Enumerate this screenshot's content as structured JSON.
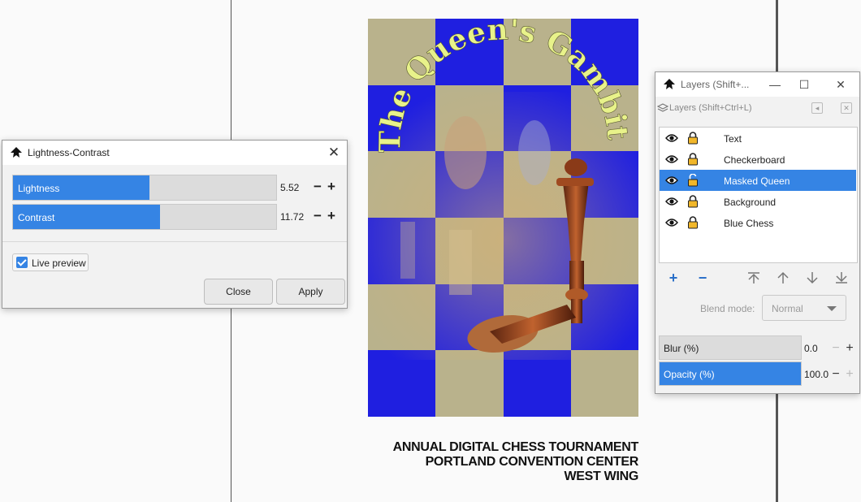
{
  "poster": {
    "title_curve": "The Queen's Gambit",
    "caption": [
      "ANNUAL DIGITAL CHESS TOURNAMENT",
      "PORTLAND CONVENTION CENTER",
      "WEST WING"
    ],
    "colors": {
      "blue": "#1f1fe0",
      "tan": "#b9b28c",
      "title": "#e8f28a"
    }
  },
  "lightness_dialog": {
    "title": "Lightness-Contrast",
    "icon": "inkscape-icon",
    "close_icon": "close-icon",
    "lightness": {
      "label": "Lightness",
      "value": "5.52",
      "level": 0.52
    },
    "contrast": {
      "label": "Contrast",
      "value": "11.72",
      "level": 0.56
    },
    "minus": "−",
    "plus": "+",
    "live_preview": {
      "label": "Live preview",
      "checked": true
    },
    "close_button": "Close",
    "apply_button": "Apply"
  },
  "layers_window": {
    "title": "Layers (Shift+...",
    "tab_title": "Layers (Shift+Ctrl+L)",
    "controls": {
      "minimize": "—",
      "maximize": "☐",
      "close": "✕"
    },
    "layers": [
      {
        "name": "Text",
        "selected": false
      },
      {
        "name": "Checkerboard",
        "selected": false
      },
      {
        "name": "Masked Queen",
        "selected": true
      },
      {
        "name": "Background",
        "selected": false
      },
      {
        "name": "Blue Chess",
        "selected": false
      }
    ],
    "tools": {
      "add": "+",
      "remove": "−"
    },
    "blend_mode_label": "Blend mode:",
    "blend_mode_value": "Normal",
    "blur": {
      "label": "Blur (%)",
      "value": "0.0",
      "level": 0.0
    },
    "opacity": {
      "label": "Opacity (%)",
      "value": "100.0",
      "level": 1.0
    },
    "minus": "−",
    "plus": "+",
    "accent": "#3584e4"
  }
}
